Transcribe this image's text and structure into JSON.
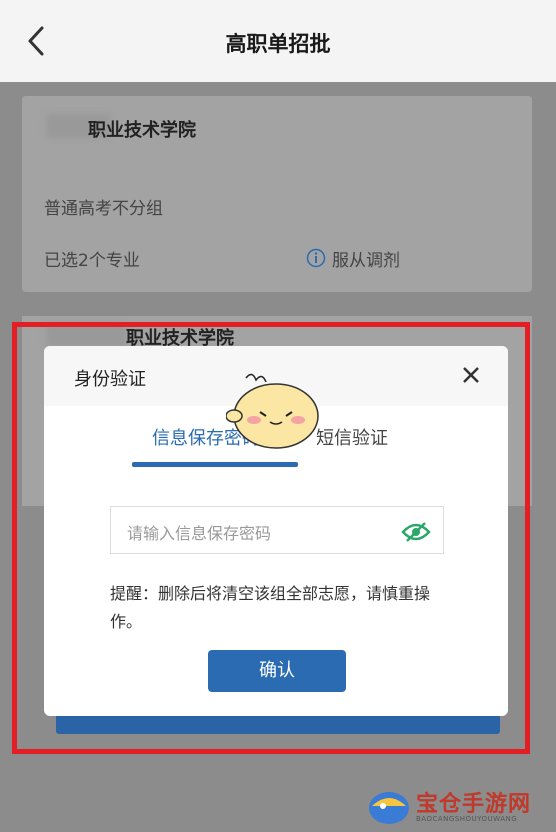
{
  "header": {
    "title": "高职单招批"
  },
  "card1": {
    "school": "职业技术学院",
    "group": "普通高考不分组",
    "selected": "已选2个专业",
    "adjust": "服从调剂"
  },
  "card2": {
    "school": "职业技术学院"
  },
  "dialog": {
    "title": "身份验证",
    "tabs": [
      "信息保存密码",
      "短信验证"
    ],
    "password_placeholder": "请输入信息保存密码",
    "reminder": "提醒：删除后将清空该组全部志愿，请慎重操作。",
    "confirm": "确认"
  },
  "watermark": {
    "name": "宝仓手游网",
    "sub": "BAOCANGSHOUYOUWANG"
  },
  "colors": {
    "accent": "#2a6bb2",
    "highlight_frame": "#e41e25"
  }
}
